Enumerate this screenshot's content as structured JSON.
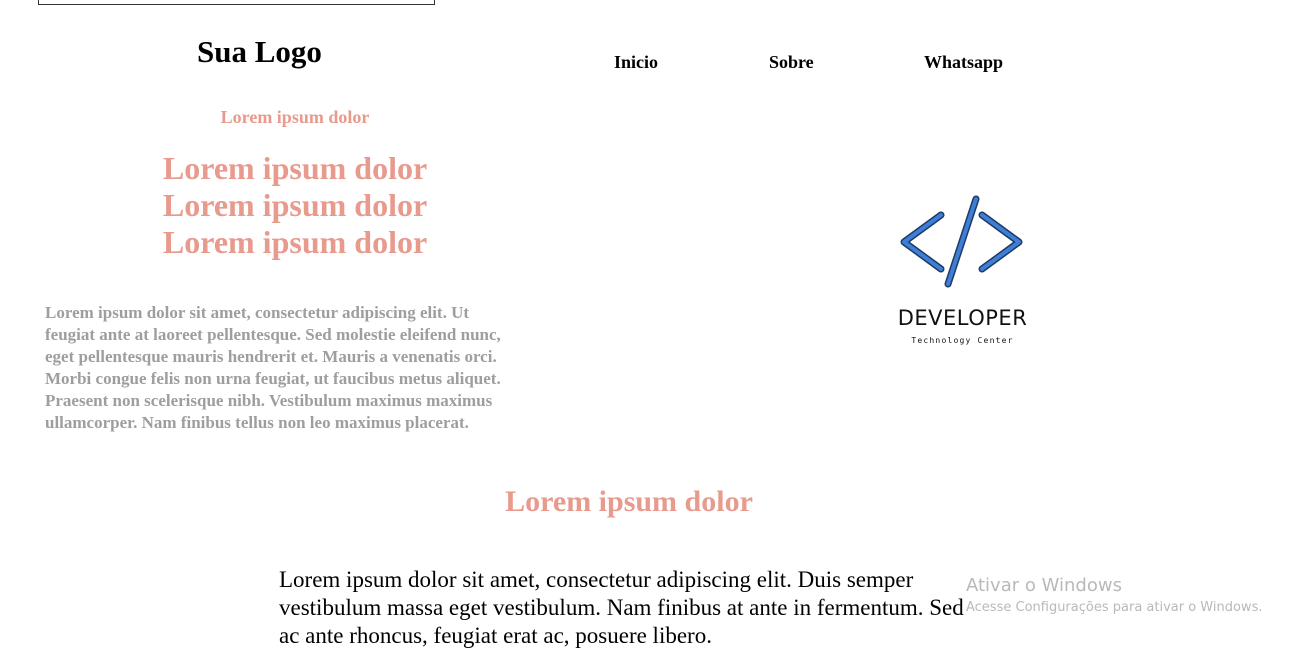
{
  "header": {
    "logo_text": "Sua Logo",
    "nav": {
      "inicio": "Inicio",
      "sobre": "Sobre",
      "whatsapp": "Whatsapp"
    }
  },
  "hero": {
    "kicker": "Lorem ipsum dolor",
    "headlines": [
      "Lorem ipsum dolor",
      "Lorem ipsum dolor",
      "Lorem ipsum dolor"
    ],
    "paragraph": "Lorem ipsum dolor sit amet, consectetur adipiscing elit. Ut feugiat ante at laoreet pellentesque. Sed molestie eleifend nunc, eget pellentesque mauris hendrerit et. Mauris a venenatis orci. Morbi congue felis non urna feugiat, ut faucibus metus aliquet. Praesent non scelerisque nibh. Vestibulum maximus maximus ullamcorper. Nam finibus tellus non leo maximus placerat."
  },
  "developer_logo": {
    "icon": "code-brackets-icon",
    "title": "DEVELOPER",
    "subtitle": "Technology Center"
  },
  "section": {
    "title": "Lorem ipsum dolor",
    "paragraph": "Lorem ipsum dolor sit amet, consectetur adipiscing elit. Duis semper vestibulum massa eget vestibulum. Nam finibus at ante in fermentum. Sed ac ante rhoncus, feugiat erat ac, posuere libero."
  },
  "windows_watermark": {
    "title": "Ativar o Windows",
    "subtitle": "Acesse Configurações para ativar o Windows."
  },
  "colors": {
    "accent": "#e89a8d",
    "muted_text": "#9e9e9e",
    "icon_blue": "#3d7fd6",
    "icon_outline": "#1f3a66"
  }
}
